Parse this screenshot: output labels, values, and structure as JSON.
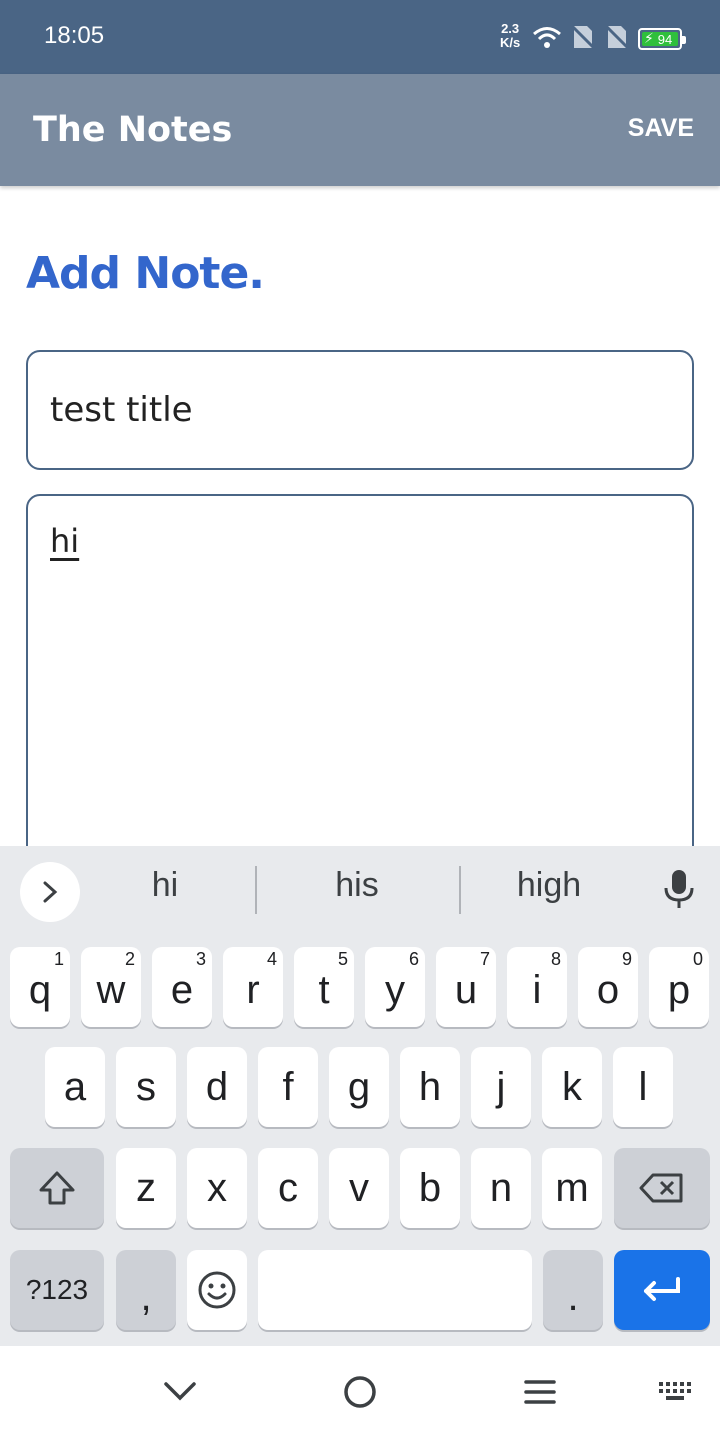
{
  "status_bar": {
    "time": "18:05",
    "speed_value": "2.3",
    "speed_unit": "K/s",
    "battery": "94"
  },
  "app_bar": {
    "title": "The Notes",
    "save_label": "SAVE"
  },
  "page": {
    "heading": "Add Note.",
    "title_value": "test title",
    "body_value": "hi"
  },
  "keyboard": {
    "suggestions": [
      "hi",
      "his",
      "high"
    ],
    "row1": [
      {
        "k": "q",
        "h": "1"
      },
      {
        "k": "w",
        "h": "2"
      },
      {
        "k": "e",
        "h": "3"
      },
      {
        "k": "r",
        "h": "4"
      },
      {
        "k": "t",
        "h": "5"
      },
      {
        "k": "y",
        "h": "6"
      },
      {
        "k": "u",
        "h": "7"
      },
      {
        "k": "i",
        "h": "8"
      },
      {
        "k": "o",
        "h": "9"
      },
      {
        "k": "p",
        "h": "0"
      }
    ],
    "row2": [
      "a",
      "s",
      "d",
      "f",
      "g",
      "h",
      "j",
      "k",
      "l"
    ],
    "row3": [
      "z",
      "x",
      "c",
      "v",
      "b",
      "n",
      "m"
    ],
    "symbols_label": "?123",
    "comma_label": ",",
    "period_label": ".",
    "enter_color": "#1a73e8"
  },
  "colors": {
    "status_bar": "#4a6585",
    "app_bar": "#7a8ba0",
    "heading": "#3366cc",
    "field_border": "#4a6585"
  }
}
